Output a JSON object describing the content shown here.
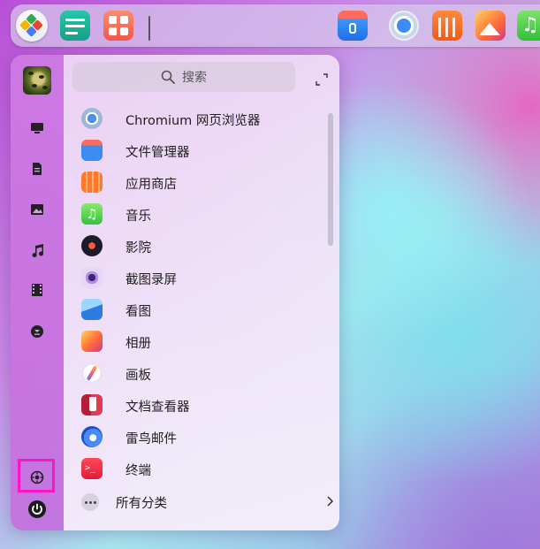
{
  "dock": {
    "apps": [
      {
        "name": "launcher-icon"
      },
      {
        "name": "system-monitor-icon"
      },
      {
        "name": "app-grid-icon"
      },
      {
        "name": "file-manager-icon"
      },
      {
        "name": "chromium-icon"
      },
      {
        "name": "app-store-icon"
      },
      {
        "name": "image-viewer-icon"
      },
      {
        "name": "music-icon"
      }
    ],
    "music_glyph": "♫"
  },
  "sidebar": {
    "items": [
      {
        "name": "sidebar-desktop-icon"
      },
      {
        "name": "sidebar-documents-icon"
      },
      {
        "name": "sidebar-pictures-icon"
      },
      {
        "name": "sidebar-music-icon"
      },
      {
        "name": "sidebar-videos-icon"
      },
      {
        "name": "sidebar-downloads-icon"
      },
      {
        "name": "sidebar-settings-icon"
      },
      {
        "name": "sidebar-power-icon"
      }
    ],
    "highlight_color": "#ff14c8"
  },
  "search": {
    "placeholder": "搜索",
    "icon": "search-icon"
  },
  "apps": [
    {
      "label": "Chromium 网页浏览器",
      "icon": "chromium-icon"
    },
    {
      "label": "文件管理器",
      "icon": "file-manager-icon"
    },
    {
      "label": "应用商店",
      "icon": "app-store-icon"
    },
    {
      "label": "音乐",
      "icon": "music-icon"
    },
    {
      "label": "影院",
      "icon": "movie-icon"
    },
    {
      "label": "截图录屏",
      "icon": "screenshot-icon"
    },
    {
      "label": "看图",
      "icon": "image-viewer-icon"
    },
    {
      "label": "相册",
      "icon": "album-icon"
    },
    {
      "label": "画板",
      "icon": "draw-icon"
    },
    {
      "label": "文档查看器",
      "icon": "document-viewer-icon"
    },
    {
      "label": "雷鸟邮件",
      "icon": "mail-icon"
    },
    {
      "label": "终端",
      "icon": "terminal-icon"
    }
  ],
  "all_categories": {
    "label": "所有分类",
    "icon": "more-icon"
  },
  "terminal_glyph": ">_"
}
